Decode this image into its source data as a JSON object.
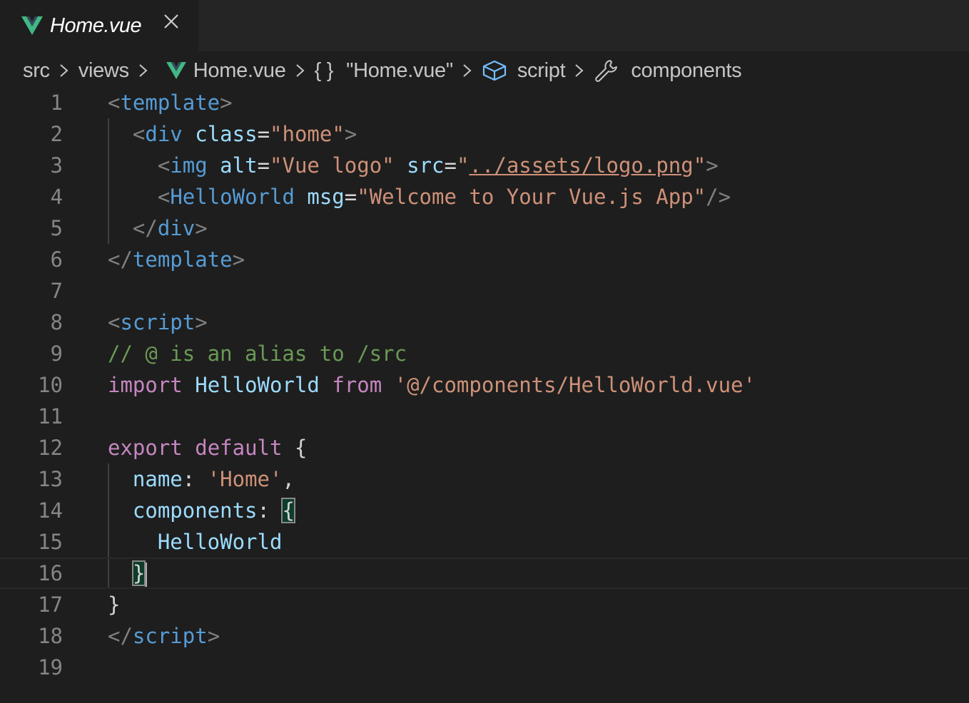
{
  "colors": {
    "vue_green": "#41b883",
    "vue_dark": "#34495e",
    "editor_bg": "#1e1e1e",
    "tab_bar_bg": "#252526",
    "icon_blue": "#75beff"
  },
  "tab": {
    "title": "Home.vue",
    "icon": "vue-icon",
    "close_icon": "close-icon"
  },
  "breadcrumb": {
    "items": [
      "src",
      "views",
      "Home.vue",
      "\"Home.vue\"",
      "script",
      "components"
    ],
    "icons": [
      "",
      "",
      "vue-icon",
      "braces-icon",
      "cube-icon",
      "wrench-icon"
    ],
    "braces_glyph": "{ }"
  },
  "editor": {
    "line_numbers": [
      "1",
      "2",
      "3",
      "4",
      "5",
      "6",
      "7",
      "8",
      "9",
      "10",
      "11",
      "12",
      "13",
      "14",
      "15",
      "16",
      "17",
      "18",
      "19"
    ],
    "current_line": 16,
    "lines": [
      [
        [
          "t-punc",
          "<"
        ],
        [
          "t-tag",
          "template"
        ],
        [
          "t-punc",
          ">"
        ]
      ],
      [
        [
          "t-text",
          "  "
        ],
        [
          "t-punc",
          "<"
        ],
        [
          "t-tag",
          "div"
        ],
        [
          "t-text",
          " "
        ],
        [
          "t-attr",
          "class"
        ],
        [
          "t-text",
          "="
        ],
        [
          "t-str",
          "\"home\""
        ],
        [
          "t-punc",
          ">"
        ]
      ],
      [
        [
          "t-text",
          "    "
        ],
        [
          "t-punc",
          "<"
        ],
        [
          "t-tag",
          "img"
        ],
        [
          "t-text",
          " "
        ],
        [
          "t-attr",
          "alt"
        ],
        [
          "t-text",
          "="
        ],
        [
          "t-str",
          "\"Vue logo\""
        ],
        [
          "t-text",
          " "
        ],
        [
          "t-attr",
          "src"
        ],
        [
          "t-text",
          "="
        ],
        [
          "t-str",
          "\""
        ],
        [
          "t-str t-link",
          "../assets/logo.png"
        ],
        [
          "t-str",
          "\""
        ],
        [
          "t-punc",
          ">"
        ]
      ],
      [
        [
          "t-text",
          "    "
        ],
        [
          "t-punc",
          "<"
        ],
        [
          "t-tag",
          "HelloWorld"
        ],
        [
          "t-text",
          " "
        ],
        [
          "t-attr",
          "msg"
        ],
        [
          "t-text",
          "="
        ],
        [
          "t-str",
          "\"Welcome to Your Vue.js App\""
        ],
        [
          "t-punc",
          "/>"
        ]
      ],
      [
        [
          "t-text",
          "  "
        ],
        [
          "t-punc",
          "</"
        ],
        [
          "t-tag",
          "div"
        ],
        [
          "t-punc",
          ">"
        ]
      ],
      [
        [
          "t-punc",
          "</"
        ],
        [
          "t-tag",
          "template"
        ],
        [
          "t-punc",
          ">"
        ]
      ],
      [],
      [
        [
          "t-punc",
          "<"
        ],
        [
          "t-tag",
          "script"
        ],
        [
          "t-punc",
          ">"
        ]
      ],
      [
        [
          "t-com",
          "// @ is an alias to /src"
        ]
      ],
      [
        [
          "t-key",
          "import"
        ],
        [
          "t-text",
          " "
        ],
        [
          "t-var",
          "HelloWorld"
        ],
        [
          "t-text",
          " "
        ],
        [
          "t-key",
          "from"
        ],
        [
          "t-text",
          " "
        ],
        [
          "t-str",
          "'@/components/HelloWorld.vue'"
        ]
      ],
      [],
      [
        [
          "t-key",
          "export"
        ],
        [
          "t-text",
          " "
        ],
        [
          "t-key",
          "default"
        ],
        [
          "t-text",
          " {"
        ]
      ],
      [
        [
          "t-text",
          "  "
        ],
        [
          "t-var",
          "name"
        ],
        [
          "t-text",
          ": "
        ],
        [
          "t-str",
          "'Home'"
        ],
        [
          "t-text",
          ","
        ]
      ],
      [
        [
          "t-text",
          "  "
        ],
        [
          "t-var",
          "components"
        ],
        [
          "t-text",
          ": "
        ],
        [
          "t-text bracket-match",
          "{"
        ]
      ],
      [
        [
          "t-text",
          "    "
        ],
        [
          "t-var",
          "HelloWorld"
        ]
      ],
      [
        [
          "t-text",
          "  "
        ],
        [
          "t-text bracket-match",
          "}"
        ],
        [
          "cursor",
          ""
        ]
      ],
      [
        [
          "t-text",
          "}"
        ]
      ],
      [
        [
          "t-punc",
          "</"
        ],
        [
          "t-tag",
          "script"
        ],
        [
          "t-punc",
          ">"
        ]
      ],
      []
    ]
  }
}
